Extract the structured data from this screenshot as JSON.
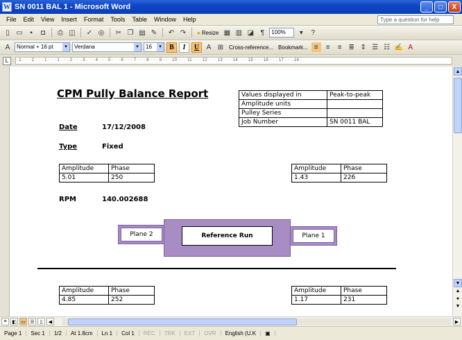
{
  "window": {
    "title": "SN 0011 BAL 1 - Microsoft Word",
    "app_icon": "W",
    "buttons": {
      "minimize": "_",
      "maximize": "□",
      "close": "X"
    }
  },
  "menubar": {
    "items": [
      "File",
      "Edit",
      "View",
      "Insert",
      "Format",
      "Tools",
      "Table",
      "Window",
      "Help"
    ],
    "help_placeholder": "Type a question for help"
  },
  "standard_toolbar": {
    "resize_label": "Resize",
    "zoom": "100%"
  },
  "format_toolbar": {
    "style": "Normal + 16 pt",
    "font": "Verdana",
    "size": "16",
    "bold": "B",
    "italic": "I",
    "underline": "U",
    "cross_reference": "Cross-reference...",
    "bookmark": "Bookmark..."
  },
  "ruler": {
    "marks": "· 1 · · · 2 · · · 1 · · · 1 · · · 2 · · · 3 · · · 4 · · · 5 · · · 6 · · · 7 · · · 8 · · · 9 · · · 10 · · · 11 · · · 12 · · · 13 · · · 14 · · · 15 · · · 16 · · · 17 · · · 18 ·"
  },
  "document": {
    "title": "CPM Pully Balance Report",
    "info_table": [
      {
        "label": "Values displayed in",
        "value": "Peak-to-peak"
      },
      {
        "label": "Amplitude units",
        "value": ""
      },
      {
        "label": "Pulley Series",
        "value": ""
      },
      {
        "label": "Job Number",
        "value": "SN 0011 BAL"
      }
    ],
    "date_label": "Date",
    "date_value": "17/12/2008",
    "type_label": "Type",
    "type_value": "Fixed",
    "rpm_label": "RPM",
    "rpm_value": "140.002688",
    "amp_header": "Amplitude",
    "phase_header": "Phase",
    "tables": [
      {
        "amplitude": "5.01",
        "phase": "250"
      },
      {
        "amplitude": "1.43",
        "phase": "226"
      },
      {
        "amplitude": "4.85",
        "phase": "252"
      },
      {
        "amplitude": "1.17",
        "phase": "231"
      }
    ],
    "plane2": "Plane 2",
    "plane1": "Plane 1",
    "reference_run": "Reference Run"
  },
  "statusbar": {
    "page": "Page 1",
    "sec": "Sec 1",
    "pages": "1/2",
    "at": "At 1.8cm",
    "ln": "Ln 1",
    "col": "Col 1",
    "rec": "REC",
    "trk": "TRK",
    "ext": "EXT",
    "ovr": "OVR",
    "language": "English (U.K"
  }
}
